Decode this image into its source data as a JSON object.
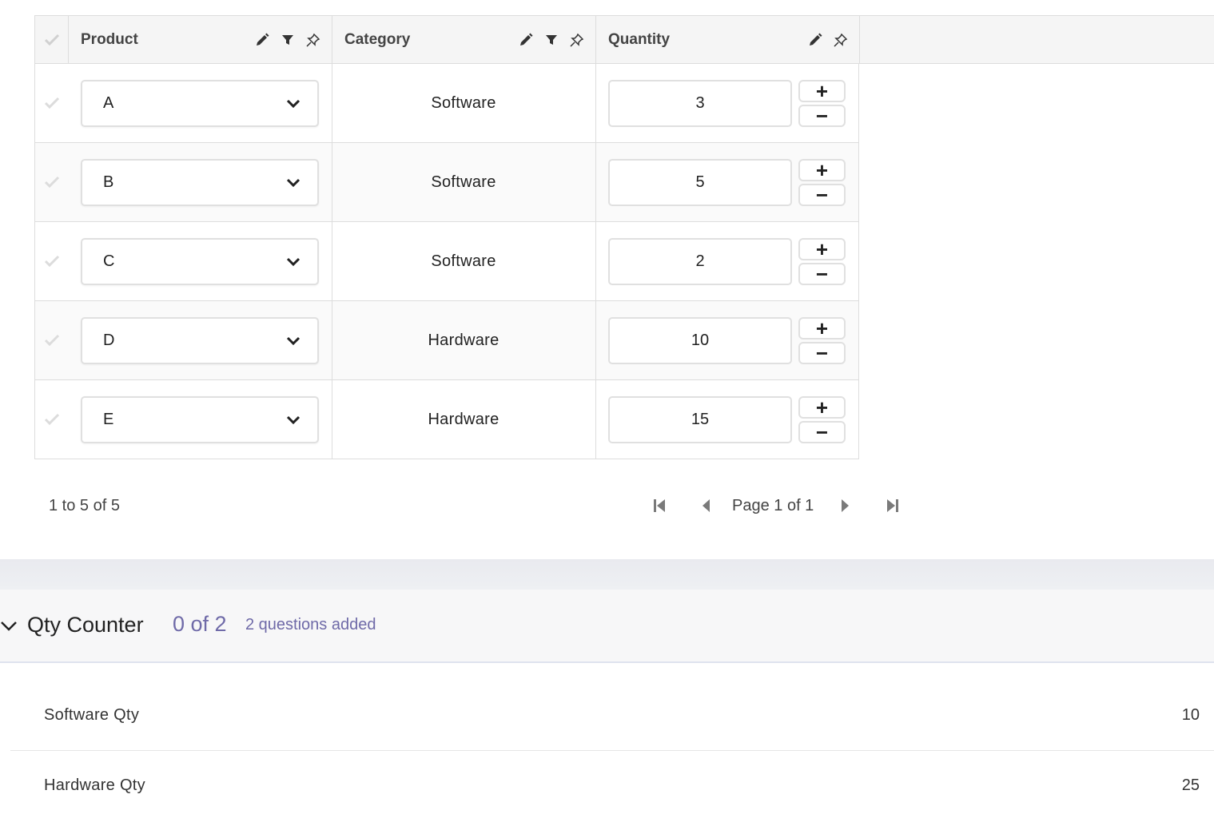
{
  "grid": {
    "columns": [
      {
        "label": "Product",
        "icons": [
          "pencil-icon",
          "filter-icon",
          "pin-icon"
        ]
      },
      {
        "label": "Category",
        "icons": [
          "pencil-icon",
          "filter-icon",
          "pin-icon"
        ]
      },
      {
        "label": "Quantity",
        "icons": [
          "pencil-icon",
          "pin-icon"
        ]
      }
    ],
    "rows": [
      {
        "product": "A",
        "category": "Software",
        "quantity": "3"
      },
      {
        "product": "B",
        "category": "Software",
        "quantity": "5"
      },
      {
        "product": "C",
        "category": "Software",
        "quantity": "2"
      },
      {
        "product": "D",
        "category": "Hardware",
        "quantity": "10"
      },
      {
        "product": "E",
        "category": "Hardware",
        "quantity": "15"
      }
    ],
    "step_plus": "+",
    "step_minus": "−"
  },
  "pagination": {
    "summary": "1 to 5 of 5",
    "page_text": "Page 1 of 1"
  },
  "section": {
    "title": "Qty Counter",
    "count": "0 of 2",
    "subtitle": "2 questions added",
    "questions": [
      {
        "label": "Software Qty",
        "value": "10"
      },
      {
        "label": "Hardware Qty",
        "value": "25"
      }
    ]
  },
  "colors": {
    "accent": "#6f6aa8",
    "border": "#dddddd",
    "header_bg": "#f5f5f5"
  }
}
